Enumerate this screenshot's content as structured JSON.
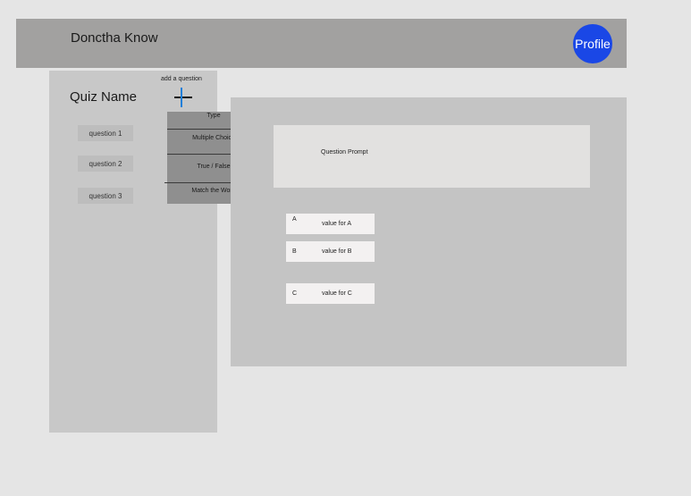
{
  "header": {
    "title": "Donctha Know",
    "profile_label": "Profile"
  },
  "sidebar": {
    "quiz_name": "Quiz Name",
    "add_question_label": "add a question",
    "questions": [
      "question 1",
      "question 2",
      "question 3"
    ]
  },
  "type_menu": {
    "header": "Type",
    "options": [
      "Multiple Choice",
      "True / False",
      "Match the Word"
    ]
  },
  "main": {
    "prompt": "Question Prompt",
    "answers": [
      {
        "letter": "A",
        "value": "value for A"
      },
      {
        "letter": "B",
        "value": "value for B"
      },
      {
        "letter": "C",
        "value": "value for C"
      }
    ]
  },
  "colors": {
    "profile": "#1a47e6",
    "plus_vertical": "#1e7fd9"
  }
}
